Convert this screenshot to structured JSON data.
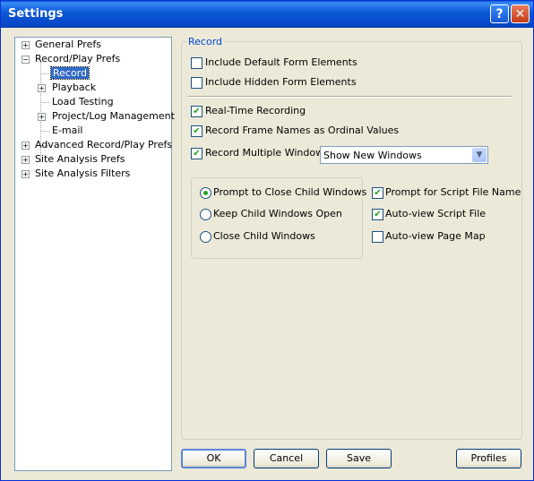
{
  "window": {
    "title": "Settings",
    "help_icon": "?",
    "close_icon": "✕"
  },
  "tree": {
    "items": [
      {
        "label": "General Prefs",
        "expander": "+"
      },
      {
        "label": "Record/Play Prefs",
        "expander": "−"
      },
      {
        "label": "Record"
      },
      {
        "label": "Playback",
        "expander": "+"
      },
      {
        "label": "Load Testing"
      },
      {
        "label": "Project/Log Management",
        "expander": "+"
      },
      {
        "label": "E-mail"
      },
      {
        "label": "Advanced Record/Play Prefs",
        "expander": "+"
      },
      {
        "label": "Site Analysis Prefs",
        "expander": "+"
      },
      {
        "label": "Site Analysis Filters",
        "expander": "+"
      }
    ]
  },
  "record": {
    "group_title": "Record",
    "include_default_form_elements": {
      "label": "Include Default Form Elements",
      "checked": false
    },
    "include_hidden_form_elements": {
      "label": "Include Hidden Form Elements",
      "checked": false
    },
    "real_time_recording": {
      "label": "Real-Time Recording",
      "checked": true
    },
    "record_frame_names": {
      "label": "Record Frame Names as Ordinal Values",
      "checked": true
    },
    "record_multiple_windows": {
      "label": "Record Multiple Windows",
      "checked": true
    },
    "windows_mode": {
      "value": "Show New Windows",
      "arrow": "▼"
    },
    "radios": [
      {
        "label": "Prompt to Close Child Windows",
        "selected": true
      },
      {
        "label": "Keep Child Windows Open",
        "selected": false
      },
      {
        "label": "Close Child Windows",
        "selected": false
      }
    ],
    "prompt_script_file_name": {
      "label": "Prompt for Script File Name",
      "checked": true
    },
    "auto_view_script_file": {
      "label": "Auto-view Script File",
      "checked": true
    },
    "auto_view_page_map": {
      "label": "Auto-view Page Map",
      "checked": false
    }
  },
  "check_glyph": "✔",
  "buttons": {
    "ok": "OK",
    "cancel": "Cancel",
    "save": "Save",
    "profiles": "Profiles"
  }
}
